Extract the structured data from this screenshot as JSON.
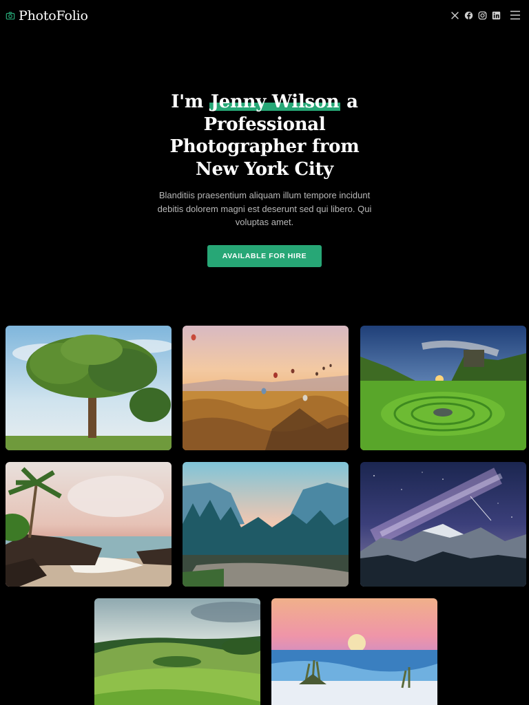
{
  "brand": {
    "name": "PhotoFolio"
  },
  "social": [
    "x-twitter-icon",
    "facebook-icon",
    "instagram-icon",
    "linkedin-icon"
  ],
  "hero": {
    "title_prefix": "I'm",
    "highlight_name": "Jenny Wilson",
    "title_suffix": "a Professional Photographer from New York City",
    "description": "Blanditiis praesentium aliquam illum tempore incidunt debitis dolorem magni est deserunt sed qui libero. Qui voluptas amet.",
    "cta": "AVAILABLE FOR HIRE"
  },
  "colors": {
    "accent": "#27a776",
    "background": "#000000"
  }
}
